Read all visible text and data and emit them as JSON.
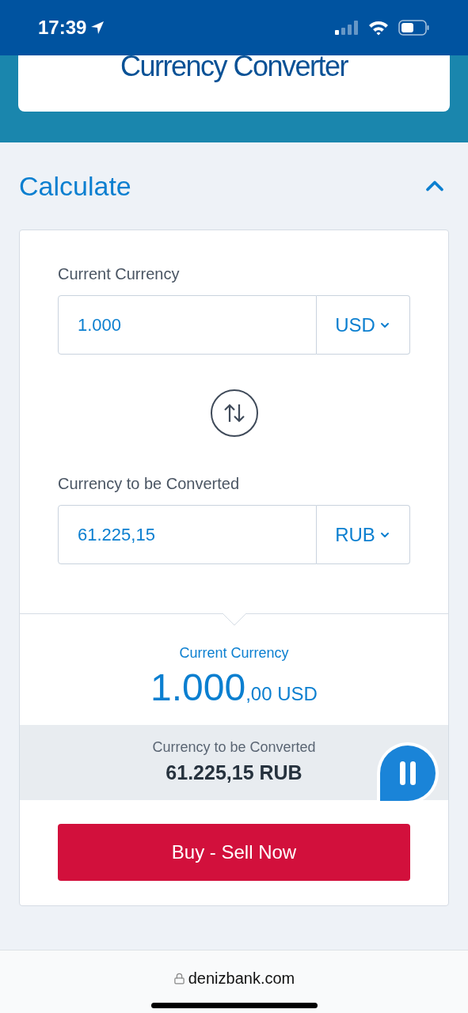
{
  "status_bar": {
    "time": "17:39"
  },
  "header": {
    "title": "Currency Converter"
  },
  "section": {
    "title": "Calculate",
    "expanded": true
  },
  "fields": [
    {
      "label": "Current Currency",
      "value": "1.000",
      "currency": "USD"
    },
    {
      "label": "Currency to be Converted",
      "value": "61.225,15",
      "currency": "RUB"
    }
  ],
  "result": {
    "label": "Current Currency",
    "amount_whole": "1.000",
    "amount_rest": ",00 USD",
    "converted_label": "Currency to be Converted",
    "converted_value": "61.225,15 RUB"
  },
  "button": "Buy - Sell Now",
  "browser": {
    "url": "denizbank.com"
  }
}
